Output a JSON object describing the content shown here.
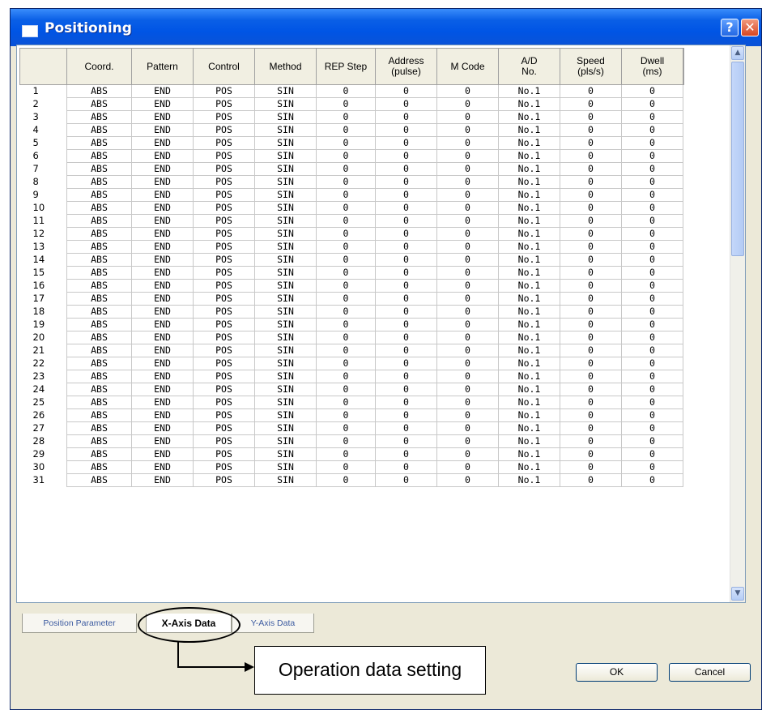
{
  "window": {
    "title": "Positioning",
    "help_glyph": "?",
    "close_glyph": "✕"
  },
  "table": {
    "columns": [
      "Coord.",
      "Pattern",
      "Control",
      "Method",
      "REP Step",
      "Address\n(pulse)",
      "M Code",
      "A/D\nNo.",
      "Speed\n(pls/s)",
      "Dwell\n(ms)"
    ],
    "row_values": [
      "ABS",
      "END",
      "POS",
      "SIN",
      "0",
      "0",
      "0",
      "No.1",
      "0",
      "0"
    ],
    "row_numbers": [
      "1",
      "2",
      "3",
      "4",
      "5",
      "6",
      "7",
      "8",
      "9",
      "10",
      "11",
      "12",
      "13",
      "14",
      "15",
      "16",
      "17",
      "18",
      "19",
      "20",
      "21",
      "22",
      "23",
      "24",
      "25",
      "26",
      "27",
      "28",
      "29",
      "30",
      "31"
    ]
  },
  "tabs": [
    "Position Parameter",
    "X-Axis Data",
    "Y-Axis Data"
  ],
  "active_tab": "X-Axis Data",
  "callout": "Operation data setting",
  "buttons": {
    "ok": "OK",
    "cancel": "Cancel"
  },
  "icons": {
    "scroll_up": "chevron-up-icon",
    "scroll_down": "chevron-down-icon"
  }
}
